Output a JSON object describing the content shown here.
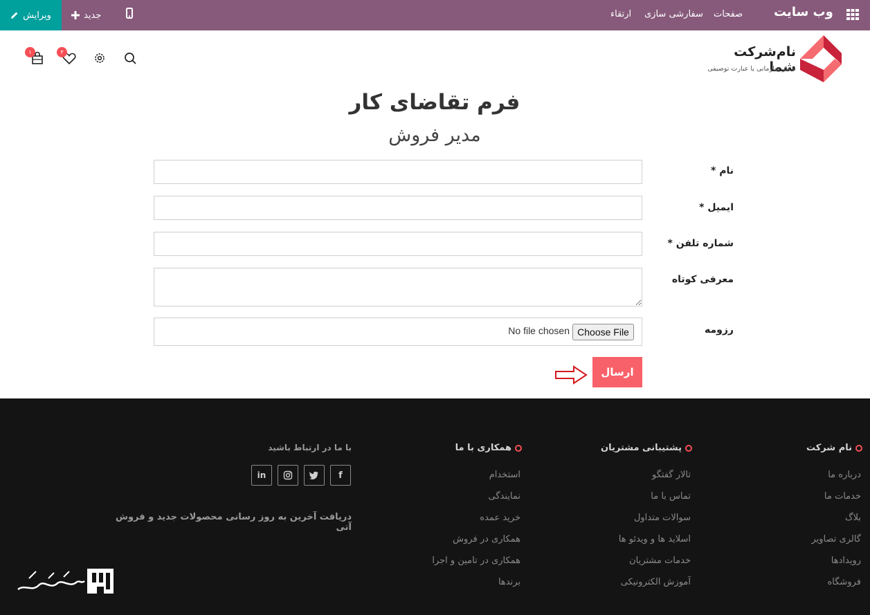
{
  "topbar": {
    "edit_label": "ویرایش",
    "new_label": "جدید",
    "title": "وب سایت",
    "menu": [
      "صفحات",
      "سفارشی سازی",
      "ارتقاء"
    ]
  },
  "header": {
    "company_name": "نام‌شرکت شما",
    "slogan": "شعار سازمانی یا عبارت توصیفی",
    "cart_count": "۱",
    "wishlist_count": "۳"
  },
  "form": {
    "title": "فرم تقاضای کار",
    "subtitle": "مدیر فروش",
    "fields": [
      {
        "label": "نام *",
        "value": ""
      },
      {
        "label": "ایمیل *",
        "value": ""
      },
      {
        "label": "شماره تلفن *",
        "value": ""
      },
      {
        "label": "معرفی کوتاه",
        "value": ""
      },
      {
        "label": "رزومه"
      }
    ],
    "file_button": "Choose File",
    "file_status": "No file chosen",
    "submit_label": "ارسال"
  },
  "footer": {
    "columns": [
      {
        "heading": "نام شرکت",
        "links": [
          "درباره ما",
          "خدمات ما",
          "بلاگ",
          "گالری تصاویر",
          "رویدادها",
          "فروشگاه"
        ]
      },
      {
        "heading": "پشتیبانی مشتریان",
        "links": [
          "تالار گفتگو",
          "تماس با ما",
          "سوالات متداول",
          "اسلاید ها و ویدئو ها",
          "خدمات مشتریان",
          "آموزش الکترونیکی"
        ]
      },
      {
        "heading": "همکاری با ما",
        "links": [
          "استخدام",
          "نمایندگی",
          "خرید عمده",
          "همکاری در فروش",
          "همکاری در تامین و اجرا",
          "برندها"
        ]
      }
    ],
    "contact_heading": "با ما در ارتباط باشید",
    "newsletter": "دریافت آخرین به روز رسانی محصولات جدید و فروش آتی",
    "social": [
      "facebook-icon",
      "twitter-icon",
      "instagram-icon",
      "linkedin-icon"
    ]
  },
  "watermark_text": "تسهیل‌گستر",
  "colors": {
    "topbar": "#875a7b",
    "edit": "#00a09d",
    "submit": "#f86169",
    "footer": "#141414",
    "accent": "#f44f55"
  }
}
